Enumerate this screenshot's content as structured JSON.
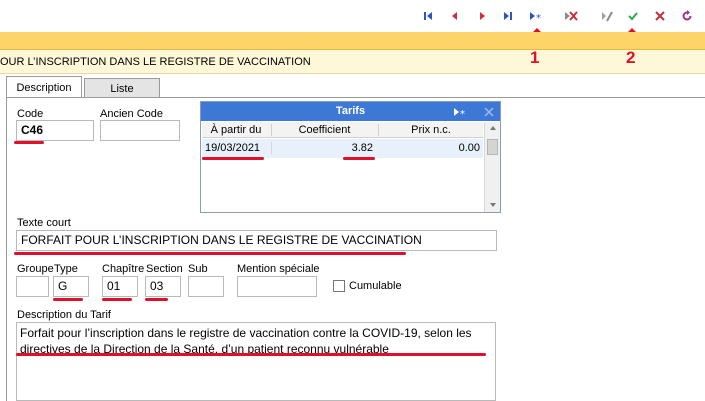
{
  "toolbar": {
    "buttons": [
      {
        "name": "first-record",
        "icon": "first-record-icon",
        "color": "#2b56c6"
      },
      {
        "name": "previous-record",
        "icon": "previous-record-icon",
        "color": "#c8323c"
      },
      {
        "name": "next-record",
        "icon": "next-record-icon",
        "color": "#c8323c"
      },
      {
        "name": "last-record",
        "icon": "last-record-icon",
        "color": "#2b56c6"
      },
      {
        "name": "new-record",
        "icon": "new-record-icon",
        "color": "#2b56c6"
      },
      {
        "name": "delete-record",
        "icon": "delete-record-icon",
        "color": "#c8323c"
      },
      {
        "name": "edit-record",
        "icon": "edit-record-icon",
        "color": "#8a8a8a"
      },
      {
        "name": "save-record",
        "icon": "check-icon",
        "color": "#2fa84f"
      },
      {
        "name": "cancel-record",
        "icon": "close-icon",
        "color": "#c8323c"
      },
      {
        "name": "refresh-record",
        "icon": "refresh-icon",
        "color": "#a0308a"
      }
    ]
  },
  "window_title": "OUR L’INSCRIPTION DANS LE REGISTRE DE VACCINATION",
  "tabs": [
    {
      "label": "Description",
      "active": true
    },
    {
      "label": "Liste",
      "active": false
    }
  ],
  "form": {
    "code_label": "Code",
    "code_value": "C46",
    "ancien_code_label": "Ancien Code",
    "ancien_code_value": "",
    "texte_court_label": "Texte court",
    "texte_court_value": "FORFAIT POUR L’INSCRIPTION DANS LE REGISTRE DE VACCINATION",
    "groupe_label": "Groupe",
    "groupe_value": "",
    "type_label": "Type",
    "type_value": "G",
    "chapitre_label": "Chapître",
    "chapitre_value": "01",
    "section_label": "Section",
    "section_value": "03",
    "sub_label": "Sub",
    "sub_value": "",
    "mention_label": "Mention spéciale",
    "mention_value": "",
    "cumulable_label": "Cumulable",
    "cumulable_checked": false,
    "description_label": "Description du Tarif",
    "description_value": "Forfait pour l’inscription dans le registre de vaccination contre la COVID-19, selon les directives de la Direction de la Santé, d’un patient reconnu vulnérable"
  },
  "tarifs": {
    "title": "Tarifs",
    "columns": [
      "À partir du",
      "Coefficient",
      "Prix n.c."
    ],
    "rows": [
      {
        "date": "19/03/2021",
        "coefficient": "3.82",
        "prix": "0.00"
      }
    ]
  },
  "annotations": {
    "marker_1": "1",
    "marker_2": "2",
    "color": "#e0102a"
  }
}
